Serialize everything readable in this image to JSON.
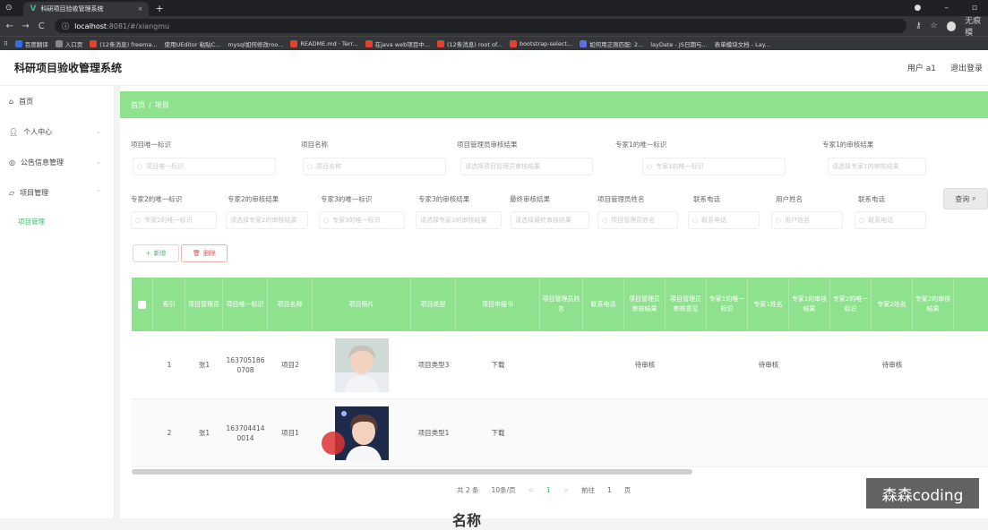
{
  "browser": {
    "tab_title": "科研项目验收管理系统",
    "url_host": "localhost",
    "url_path": ":8081/#/xiangmu",
    "bookmarks": [
      {
        "label": "百度翻译",
        "color": "#2f6fe0"
      },
      {
        "label": "入口页",
        "color": "#888"
      },
      {
        "label": "(12条消息) freema...",
        "color": "#e0432f"
      },
      {
        "label": "使用UEditor 粘贴C...",
        "color": "#555"
      },
      {
        "label": "mysql如何修改roo...",
        "color": "#555"
      },
      {
        "label": "README.md · Terr...",
        "color": "#e0432f"
      },
      {
        "label": "在java web项目中...",
        "color": "#e0432f"
      },
      {
        "label": "(12条消息) root of...",
        "color": "#e0432f"
      },
      {
        "label": "bootstrap-select...",
        "color": "#e0432f"
      },
      {
        "label": "如何用正则匹配: 2...",
        "color": "#5a6fe0"
      },
      {
        "label": "layDate - JS日期与...",
        "color": "#555"
      },
      {
        "label": "表单模块文档 - Lay...",
        "color": "#555"
      }
    ],
    "profile": "无痕模"
  },
  "header": {
    "app_name": "科研项目验收管理系统",
    "user": "用户 a1",
    "logout": "退出登录"
  },
  "sidebar": {
    "items": [
      {
        "label": "首页",
        "icon": "home-icon"
      },
      {
        "label": "个人中心",
        "icon": "user-icon"
      },
      {
        "label": "公告信息管理",
        "icon": "bell-icon"
      },
      {
        "label": "项目管理",
        "icon": "folder-icon"
      }
    ],
    "sub_item": "项目管理"
  },
  "breadcrumb": {
    "home": "首页",
    "separator": "/",
    "current": "项目"
  },
  "filters": {
    "row1": [
      {
        "label": "项目唯一标识",
        "placeholder": "项目唯一标识"
      },
      {
        "label": "项目名称",
        "placeholder": "项目名称"
      },
      {
        "label": "项目管理员审核结果",
        "placeholder": "请选择项目管理员审核结果"
      },
      {
        "label": "专家1的唯一标识",
        "placeholder": "专家1的唯一标识"
      },
      {
        "label": "专家1的审核结果",
        "placeholder": "请选择专家1的审核结果"
      }
    ],
    "row2": [
      {
        "label": "专家2的唯一标识",
        "placeholder": "专家2的唯一标识"
      },
      {
        "label": "专家2的审核结果",
        "placeholder": "请选择专家2的审核结果"
      },
      {
        "label": "专家3的唯一标识",
        "placeholder": "专家3的唯一标识"
      },
      {
        "label": "专家3的审核结果",
        "placeholder": "请选择专家3的审核结果"
      },
      {
        "label": "最终审核结果",
        "placeholder": "请选择最终审核结果"
      },
      {
        "label": "项目管理员姓名",
        "placeholder": "项目管理员姓名"
      },
      {
        "label": "联系电话",
        "placeholder": "联系电话"
      },
      {
        "label": "用户姓名",
        "placeholder": "用户姓名"
      },
      {
        "label": "联系电话",
        "placeholder": "联系电话"
      }
    ],
    "query_label": "查询"
  },
  "actions": {
    "add": "新增",
    "delete": "删除"
  },
  "table": {
    "columns": [
      "索引",
      "项目管理员",
      "项目唯一标识",
      "项目名称",
      "项目照片",
      "项目类型",
      "项目申报书",
      "项目管理员姓名",
      "联系电话",
      "项目管理员审核结果",
      "项目管理员审核意见",
      "专家1的唯一标识",
      "专家1姓名",
      "专家1的审核结果",
      "专家2的唯一标识",
      "专家2姓名",
      "专家2的审核结果"
    ],
    "rows": [
      {
        "index": "1",
        "admin": "张1",
        "id": "1637051860708",
        "name": "项目2",
        "photo": "portrait-1",
        "type": "项目类型3",
        "file": "下载",
        "r1": "待审核",
        "r2": "待审核",
        "r3": "待审核"
      },
      {
        "index": "2",
        "admin": "张1",
        "id": "1637044140014",
        "name": "项目1",
        "photo": "portrait-2",
        "type": "项目类型1",
        "file": "下载",
        "r1": "",
        "r2": "",
        "r3": ""
      }
    ]
  },
  "pagination": {
    "total": "共 2 条",
    "page_size": "10条/页",
    "prev": "<",
    "current_page": "1",
    "next": ">",
    "goto_label": "前往",
    "goto_value": "1",
    "page_unit": "页"
  },
  "watermark": "森森coding",
  "bottom_text": "名称"
}
